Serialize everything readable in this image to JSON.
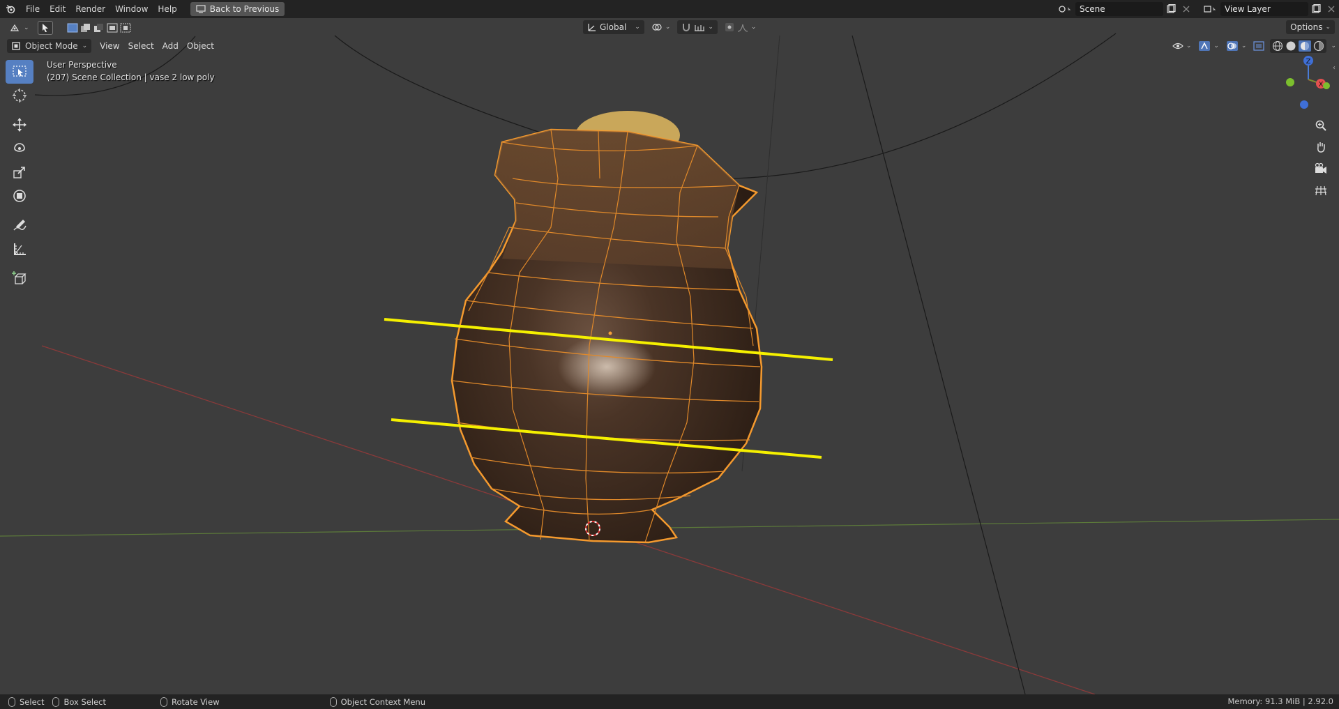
{
  "topbar": {
    "menus": [
      "File",
      "Edit",
      "Render",
      "Window",
      "Help"
    ],
    "back_button": "Back to Previous",
    "scene_name": "Scene",
    "view_layer": "View Layer"
  },
  "viewport_header": {
    "transform_orientation": "Global",
    "options_label": "Options",
    "mode": "Object Mode",
    "menus": [
      "View",
      "Select",
      "Add",
      "Object"
    ]
  },
  "viewport": {
    "perspective_label": "User Perspective",
    "collection_label": "(207) Scene Collection | vase 2 low poly",
    "gizmo_axes": {
      "z": "Z",
      "x": "X"
    }
  },
  "toolbar": {
    "tools": [
      "select-box",
      "cursor",
      "move",
      "rotate",
      "scale",
      "transform",
      "annotate",
      "measure",
      "add-cube"
    ],
    "active_tool": "select-box"
  },
  "statusbar": {
    "select": "Select",
    "box_select": "Box Select",
    "rotate_view": "Rotate View",
    "context_menu": "Object Context Menu",
    "memory": "Memory: 91.3 MiB | 2.92.0"
  },
  "colors": {
    "selection_outline": "#f59a2e",
    "annotation_lines": "#f5f000",
    "viewport_bg": "#3d3d3d",
    "active_tool": "#5680c2"
  }
}
